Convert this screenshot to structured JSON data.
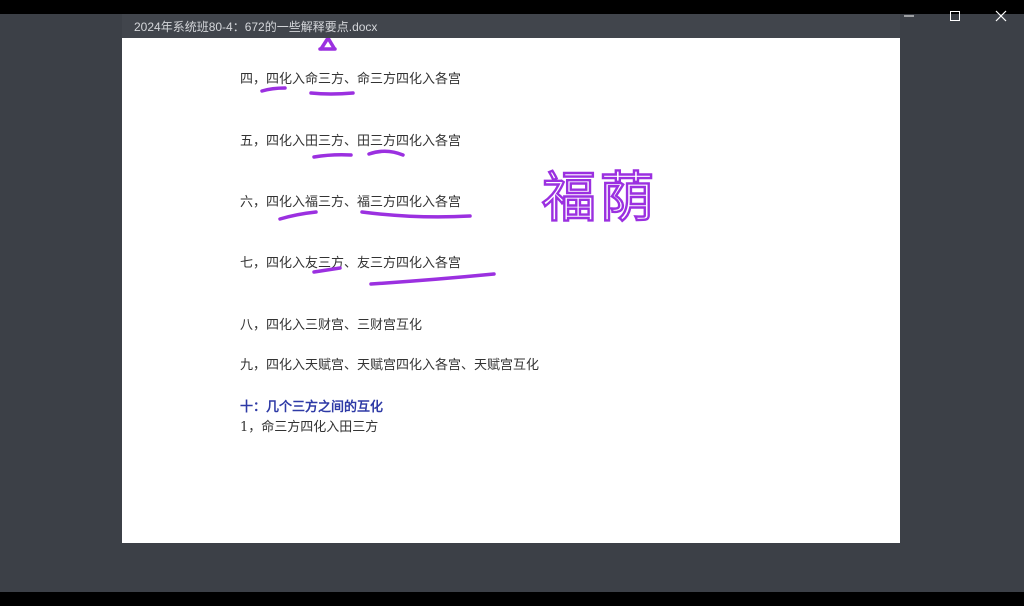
{
  "window": {
    "title": "2024年系统班80-4：672的一些解释要点.docx"
  },
  "document": {
    "lines": [
      "四，四化入命三方、命三方四化入各宫",
      "五，四化入田三方、田三方四化入各宫",
      "六，四化入福三方、福三方四化入各宫",
      "七，四化入友三方、友三方四化入各宫",
      "八，四化入三财宫、三财宫互化",
      "九，四化入天赋宫、天赋宫四化入各宫、天赋宫互化"
    ],
    "section_heading": "十：几个三方之间的互化",
    "section_item": "1，命三方四化入田三方"
  },
  "annotation": {
    "handwritten_note": "福荫",
    "ink_color": "#9b30e0"
  }
}
